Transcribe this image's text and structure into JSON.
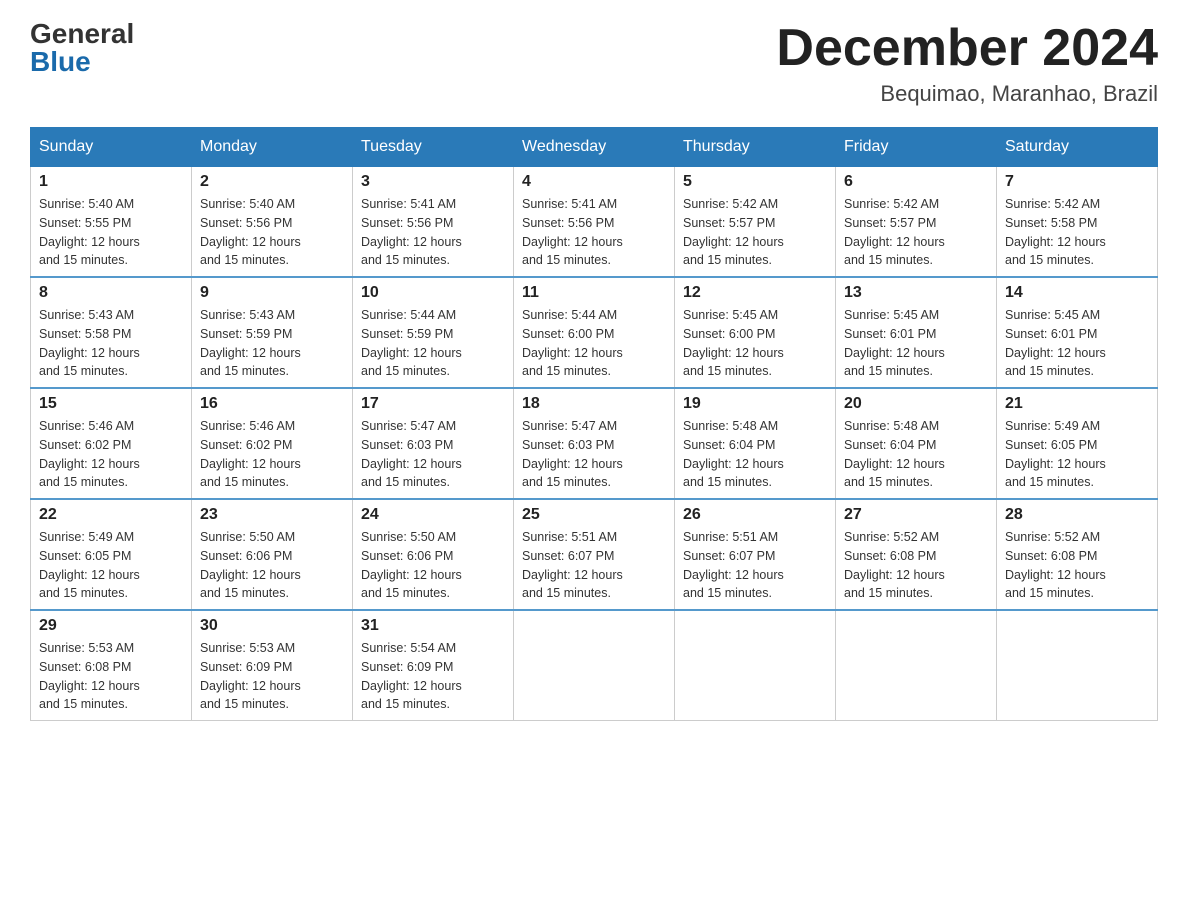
{
  "header": {
    "logo_general": "General",
    "logo_blue": "Blue",
    "month_title": "December 2024",
    "location": "Bequimao, Maranhao, Brazil"
  },
  "days_of_week": [
    "Sunday",
    "Monday",
    "Tuesday",
    "Wednesday",
    "Thursday",
    "Friday",
    "Saturday"
  ],
  "weeks": [
    [
      {
        "day": "1",
        "sunrise": "5:40 AM",
        "sunset": "5:55 PM",
        "daylight": "12 hours and 15 minutes."
      },
      {
        "day": "2",
        "sunrise": "5:40 AM",
        "sunset": "5:56 PM",
        "daylight": "12 hours and 15 minutes."
      },
      {
        "day": "3",
        "sunrise": "5:41 AM",
        "sunset": "5:56 PM",
        "daylight": "12 hours and 15 minutes."
      },
      {
        "day": "4",
        "sunrise": "5:41 AM",
        "sunset": "5:56 PM",
        "daylight": "12 hours and 15 minutes."
      },
      {
        "day": "5",
        "sunrise": "5:42 AM",
        "sunset": "5:57 PM",
        "daylight": "12 hours and 15 minutes."
      },
      {
        "day": "6",
        "sunrise": "5:42 AM",
        "sunset": "5:57 PM",
        "daylight": "12 hours and 15 minutes."
      },
      {
        "day": "7",
        "sunrise": "5:42 AM",
        "sunset": "5:58 PM",
        "daylight": "12 hours and 15 minutes."
      }
    ],
    [
      {
        "day": "8",
        "sunrise": "5:43 AM",
        "sunset": "5:58 PM",
        "daylight": "12 hours and 15 minutes."
      },
      {
        "day": "9",
        "sunrise": "5:43 AM",
        "sunset": "5:59 PM",
        "daylight": "12 hours and 15 minutes."
      },
      {
        "day": "10",
        "sunrise": "5:44 AM",
        "sunset": "5:59 PM",
        "daylight": "12 hours and 15 minutes."
      },
      {
        "day": "11",
        "sunrise": "5:44 AM",
        "sunset": "6:00 PM",
        "daylight": "12 hours and 15 minutes."
      },
      {
        "day": "12",
        "sunrise": "5:45 AM",
        "sunset": "6:00 PM",
        "daylight": "12 hours and 15 minutes."
      },
      {
        "day": "13",
        "sunrise": "5:45 AM",
        "sunset": "6:01 PM",
        "daylight": "12 hours and 15 minutes."
      },
      {
        "day": "14",
        "sunrise": "5:45 AM",
        "sunset": "6:01 PM",
        "daylight": "12 hours and 15 minutes."
      }
    ],
    [
      {
        "day": "15",
        "sunrise": "5:46 AM",
        "sunset": "6:02 PM",
        "daylight": "12 hours and 15 minutes."
      },
      {
        "day": "16",
        "sunrise": "5:46 AM",
        "sunset": "6:02 PM",
        "daylight": "12 hours and 15 minutes."
      },
      {
        "day": "17",
        "sunrise": "5:47 AM",
        "sunset": "6:03 PM",
        "daylight": "12 hours and 15 minutes."
      },
      {
        "day": "18",
        "sunrise": "5:47 AM",
        "sunset": "6:03 PM",
        "daylight": "12 hours and 15 minutes."
      },
      {
        "day": "19",
        "sunrise": "5:48 AM",
        "sunset": "6:04 PM",
        "daylight": "12 hours and 15 minutes."
      },
      {
        "day": "20",
        "sunrise": "5:48 AM",
        "sunset": "6:04 PM",
        "daylight": "12 hours and 15 minutes."
      },
      {
        "day": "21",
        "sunrise": "5:49 AM",
        "sunset": "6:05 PM",
        "daylight": "12 hours and 15 minutes."
      }
    ],
    [
      {
        "day": "22",
        "sunrise": "5:49 AM",
        "sunset": "6:05 PM",
        "daylight": "12 hours and 15 minutes."
      },
      {
        "day": "23",
        "sunrise": "5:50 AM",
        "sunset": "6:06 PM",
        "daylight": "12 hours and 15 minutes."
      },
      {
        "day": "24",
        "sunrise": "5:50 AM",
        "sunset": "6:06 PM",
        "daylight": "12 hours and 15 minutes."
      },
      {
        "day": "25",
        "sunrise": "5:51 AM",
        "sunset": "6:07 PM",
        "daylight": "12 hours and 15 minutes."
      },
      {
        "day": "26",
        "sunrise": "5:51 AM",
        "sunset": "6:07 PM",
        "daylight": "12 hours and 15 minutes."
      },
      {
        "day": "27",
        "sunrise": "5:52 AM",
        "sunset": "6:08 PM",
        "daylight": "12 hours and 15 minutes."
      },
      {
        "day": "28",
        "sunrise": "5:52 AM",
        "sunset": "6:08 PM",
        "daylight": "12 hours and 15 minutes."
      }
    ],
    [
      {
        "day": "29",
        "sunrise": "5:53 AM",
        "sunset": "6:08 PM",
        "daylight": "12 hours and 15 minutes."
      },
      {
        "day": "30",
        "sunrise": "5:53 AM",
        "sunset": "6:09 PM",
        "daylight": "12 hours and 15 minutes."
      },
      {
        "day": "31",
        "sunrise": "5:54 AM",
        "sunset": "6:09 PM",
        "daylight": "12 hours and 15 minutes."
      },
      null,
      null,
      null,
      null
    ]
  ],
  "labels": {
    "sunrise_prefix": "Sunrise: ",
    "sunset_prefix": "Sunset: ",
    "daylight_prefix": "Daylight: "
  }
}
